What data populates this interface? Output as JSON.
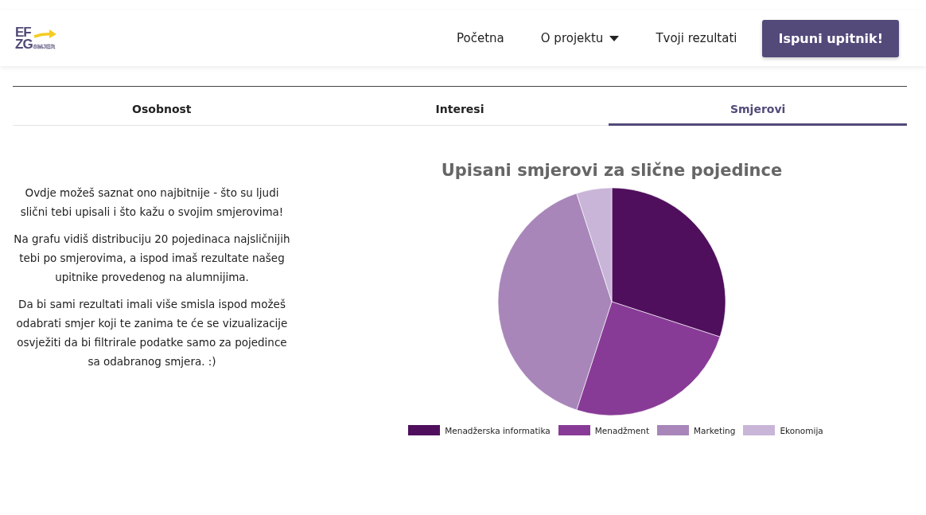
{
  "logo": {
    "line_1": "EF",
    "line_2": "ZG",
    "tagline": "SMJER"
  },
  "nav": {
    "items": [
      {
        "label": "Početna",
        "dropdown": false
      },
      {
        "label": "O projektu",
        "dropdown": true
      },
      {
        "label": "Tvoji rezultati",
        "dropdown": false
      }
    ],
    "cta": "Ispuni upitnik!"
  },
  "tabs": [
    {
      "label": "Osobnost",
      "selected": false
    },
    {
      "label": "Interesi",
      "selected": false
    },
    {
      "label": "Smjerovi",
      "selected": true
    }
  ],
  "intro": [
    "Ovdje možeš saznat ono najbitnije - što su ljudi slični tebi upisali i što kažu o svojim smjerovima!",
    "Na grafu vidiš distribuciju 20 pojedinaca najsličnijih tebi po smjerovima, a ispod imaš rezultate našeg upitnike provedenog na alumnijima.",
    "Da bi sami rezultati imali više smisla ispod možeš odabrati smjer koji te zanima te će se vizualizacije osvježiti da bi filtrirale podatke samo za pojedince sa odabranog smjera. :)"
  ],
  "chart_data": {
    "type": "pie",
    "title": "Upisani smjerovi za slične pojedince",
    "categories": [
      "Menadžerska informatika",
      "Menadžment",
      "Marketing",
      "Ekonomija"
    ],
    "values": [
      30,
      25,
      40,
      5
    ],
    "legend": true,
    "colors": [
      "#4f0f5c",
      "#883b96",
      "#a886b9",
      "#c9b5d8"
    ]
  }
}
